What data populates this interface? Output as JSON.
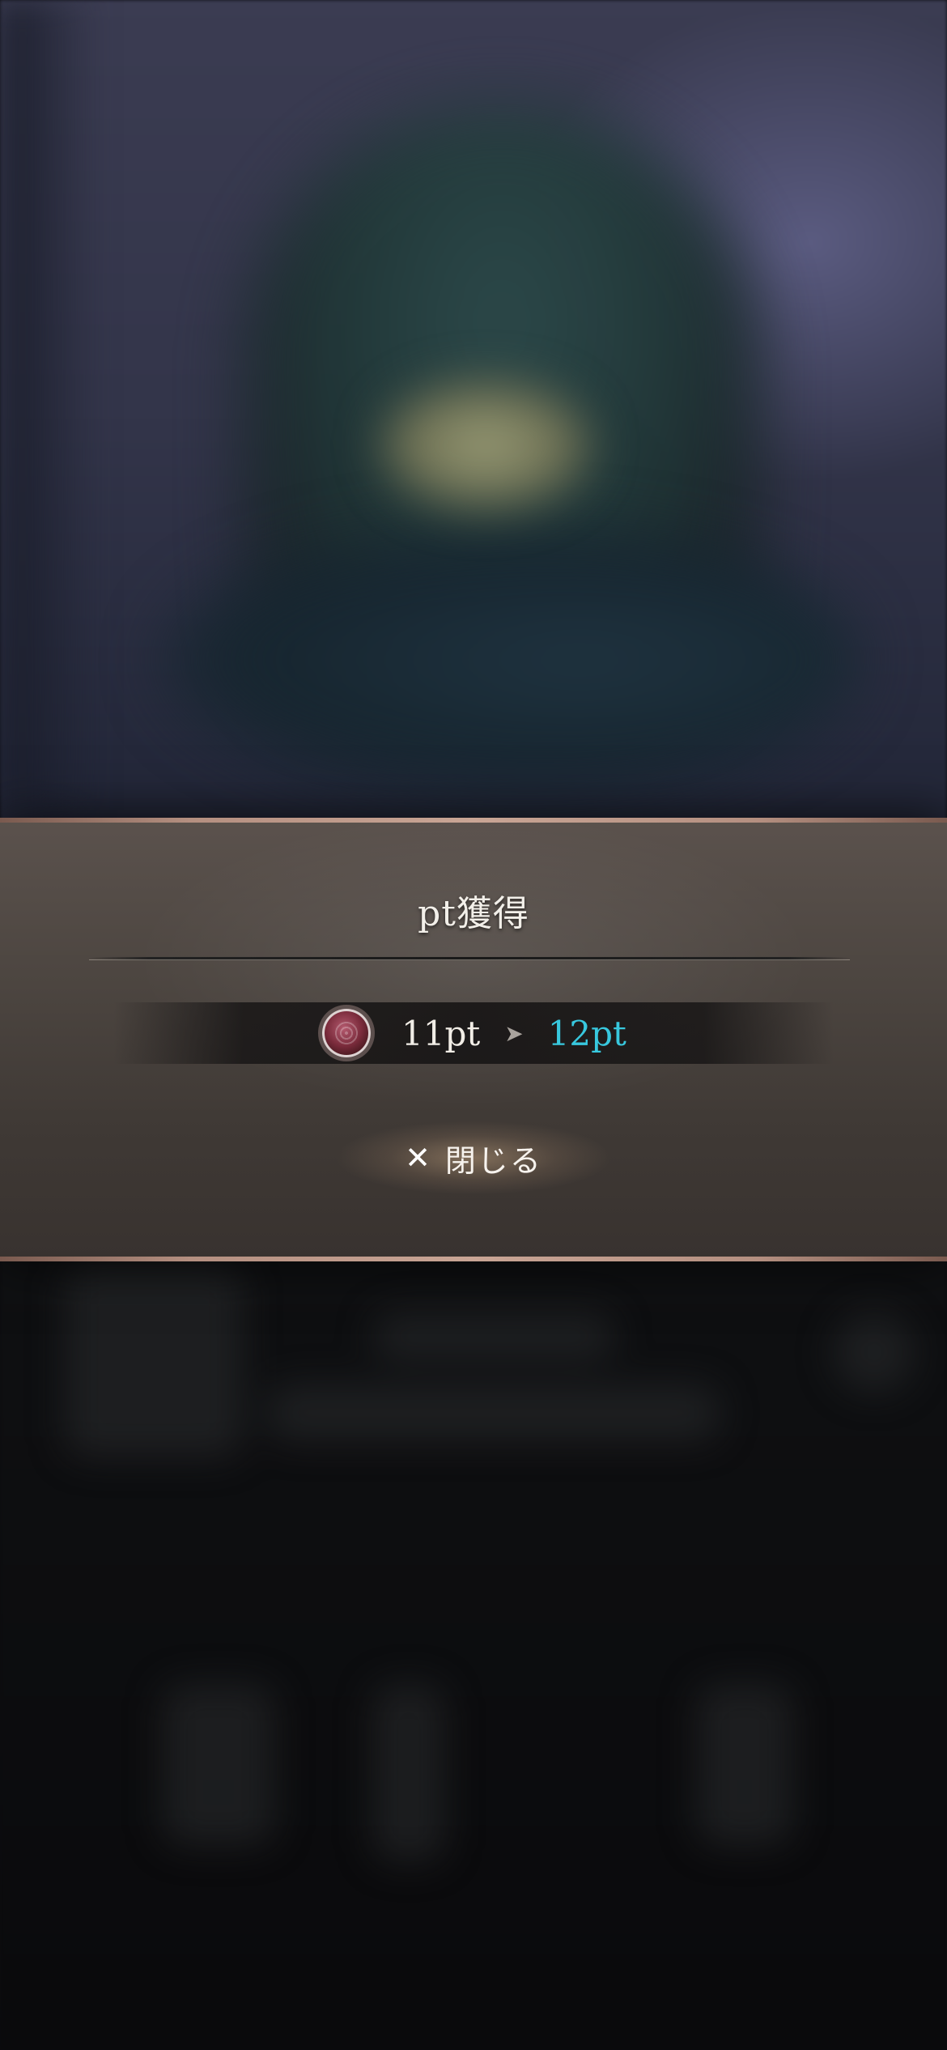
{
  "modal": {
    "title": "pt獲得",
    "points": {
      "icon": "point-gem-icon",
      "old": "11pt",
      "arrow": "➤",
      "new": "12pt",
      "new_color": "#38c8de"
    },
    "close_button": {
      "icon": "✕",
      "label": "閉じる"
    }
  }
}
